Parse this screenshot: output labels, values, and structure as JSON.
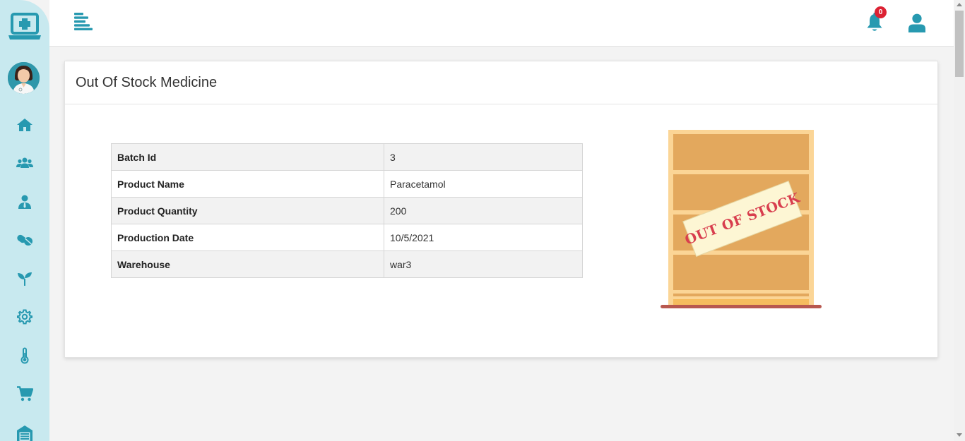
{
  "sidebar": {
    "logo_icon": "medical-laptop-icon",
    "avatar_icon": "doctor-avatar-icon",
    "items": [
      {
        "icon": "home-icon"
      },
      {
        "icon": "users-icon"
      },
      {
        "icon": "user-tie-icon"
      },
      {
        "icon": "pills-icon"
      },
      {
        "icon": "seedling-icon"
      },
      {
        "icon": "gear-icon"
      },
      {
        "icon": "thermometer-icon"
      },
      {
        "icon": "cart-icon"
      },
      {
        "icon": "warehouse-icon"
      }
    ]
  },
  "header": {
    "menu_icon": "menu-toggle-icon",
    "notification_count": "0",
    "bell_icon": "bell-icon",
    "user_icon": "user-icon"
  },
  "card": {
    "title": "Out Of Stock Medicine",
    "details": [
      {
        "label": "Batch Id",
        "value": "3"
      },
      {
        "label": "Product Name",
        "value": "Paracetamol"
      },
      {
        "label": "Product Quantity",
        "value": "200"
      },
      {
        "label": "Production Date",
        "value": "10/5/2021"
      },
      {
        "label": "Warehouse",
        "value": "war3"
      }
    ],
    "illustration": {
      "icon": "empty-shelf-illustration",
      "stamp_text": "OUT OF STOCK"
    }
  },
  "colors": {
    "accent": "#2799b0",
    "sidebar_bg": "#c8e9ef",
    "badge": "#dc2233",
    "stamp": "#d83e4e",
    "shelf": "#e3a85d"
  }
}
